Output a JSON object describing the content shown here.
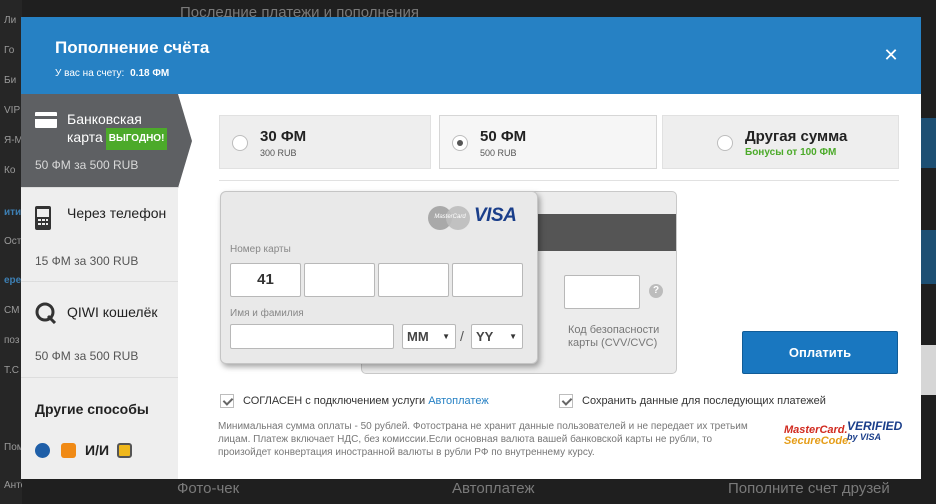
{
  "background": {
    "left_items": [
      "Ли",
      "Го",
      "Би",
      "VIP",
      "Я-М",
      "Ко",
      "ити",
      "Ост",
      "ере",
      "СМ",
      "поз",
      "Т.С",
      "Пом",
      "Антон"
    ],
    "top_text": "Последние платежи и пополнения",
    "bottom_items": [
      "Фото-чек",
      "Автоплатеж",
      "Пополните счет друзей"
    ]
  },
  "modal": {
    "title": "Пополнение счёта",
    "balance_label": "У вас на счету:",
    "balance_value": "0.18 ФМ",
    "close_icon": "close-icon"
  },
  "tabs": [
    {
      "title": "Банковская карта",
      "badge": "ВЫГОДНО!",
      "sub": "50 ФМ за 500 RUB",
      "icon": "bank-card-icon",
      "active": true
    },
    {
      "title": "Через телефон",
      "sub": "15 ФМ за 300 RUB",
      "icon": "phone-icon",
      "active": false
    },
    {
      "title": "QIWI кошелёк",
      "sub": "50 ФМ за 500 RUB",
      "icon": "qiwi-icon",
      "active": false
    },
    {
      "title": "Другие способы",
      "icons": [
        "webmoney-icon",
        "yandex-money-icon",
        "im-icon",
        "wallet-icon"
      ],
      "active": false
    }
  ],
  "amounts": [
    {
      "main": "30 ФМ",
      "sub": "300 RUB",
      "selected": false
    },
    {
      "main": "50 ФМ",
      "sub": "500 RUB",
      "selected": true
    },
    {
      "main": "Другая сумма",
      "bonus": "Бонусы от 100 ФМ",
      "selected": false
    }
  ],
  "card": {
    "number_label": "Номер карты",
    "number_parts": [
      "41",
      "",
      "",
      ""
    ],
    "name_label": "Имя и фамилия",
    "name_value": "",
    "month_value": "MM",
    "year_value": "YY",
    "separator": "/",
    "cvv_label": "Код безопасности карты (CVV/CVC)",
    "help": "?",
    "mastercard_text": "MasterCard",
    "visa_text": "VISA"
  },
  "pay_button": "Оплатить",
  "checkboxes": [
    {
      "label": "СОГЛАСЕН с подключением услуги",
      "link": "Автоплатеж",
      "checked": true
    },
    {
      "label": "Сохранить данные для последующих платежей",
      "checked": true
    }
  ],
  "disclaimer": "Минимальная сумма оплаты - 50 рублей. Фотострана не хранит данные пользователей и не передает их третьим лицам. Платеж включает НДС, без комиссии.Если основная валюта вашей банковской карты не рубли, то произойдет конвертация иностранной валюты в рубли РФ по внутреннему курсу.",
  "security_logos": {
    "mc_line1": "MasterCard.",
    "mc_line2": "SecureCode.",
    "vbv_line1": "VERIFIED",
    "vbv_line2": "by VISA"
  },
  "colors": {
    "header": "#2681c4",
    "tab_active": "#5e6063",
    "accent_green": "#4caa2a",
    "pay_button": "#1977c0"
  }
}
